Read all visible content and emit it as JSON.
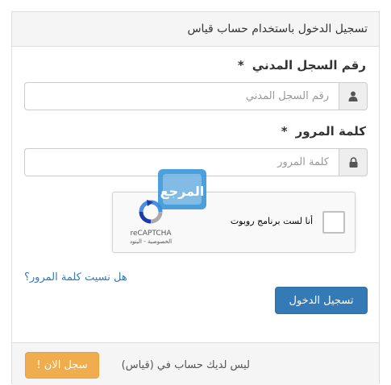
{
  "header": {
    "title": "تسجيل الدخول باستخدام حساب قياس"
  },
  "civil_id": {
    "label": "رقم السجل المدني",
    "required_mark": "*",
    "placeholder": "رقم السجل المدني",
    "value": "",
    "icon": "user-icon"
  },
  "password": {
    "label": "كلمة المرور",
    "required_mark": "*",
    "placeholder": "كلمة المرور",
    "value": "",
    "icon": "lock-icon"
  },
  "captcha": {
    "text": "أنا لست برنامج روبوت",
    "brand": "reCAPTCHA",
    "links": "الخصوصية - البنود",
    "checked": false
  },
  "watermark": {
    "text": "المرجع",
    "icon": "watermark-logo-icon"
  },
  "forgot_link": "هل نسيت كلمة المرور؟",
  "login_button": "تسجيل الدخول",
  "footer": {
    "text": "ليس لديك حساب في (قياس)",
    "register_button": "سجل الان !"
  },
  "colors": {
    "primary": "#337ab7",
    "warning": "#f0ad4e",
    "panel_bg": "#f5f5f5",
    "border": "#dddddd"
  }
}
